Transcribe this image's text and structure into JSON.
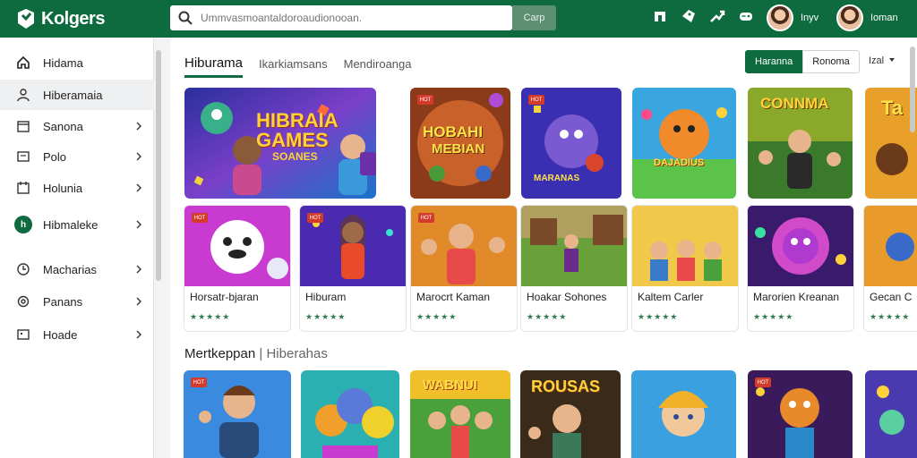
{
  "header": {
    "logo_text": "Kolgers",
    "search_placeholder": "Ummvasmoantaldoroaudionooan.",
    "search_button": "Carp",
    "user1_name": "Inyv",
    "user2_name": "Ioman"
  },
  "sidebar": {
    "items": [
      {
        "label": "Hidama",
        "icon": "home-icon",
        "chevron": false
      },
      {
        "label": "Hiberamaia",
        "icon": "user-icon",
        "chevron": false,
        "active": true
      },
      {
        "label": "Sanona",
        "icon": "calendar-icon",
        "chevron": true
      },
      {
        "label": "Polo",
        "icon": "image-icon",
        "chevron": true
      },
      {
        "label": "Holunia",
        "icon": "calendar-icon",
        "chevron": true
      },
      {
        "label": "Hibmaleke",
        "icon": "badge-icon",
        "badge": "h",
        "chevron": true
      },
      {
        "label": "Macharias",
        "icon": "clock-icon",
        "chevron": true
      },
      {
        "label": "Panans",
        "icon": "settings-icon",
        "chevron": true
      },
      {
        "label": "Hoade",
        "icon": "chat-icon",
        "chevron": true
      }
    ]
  },
  "main": {
    "tabs": [
      "Hiburama",
      "Ikarkiamsans",
      "Mendiroanga"
    ],
    "active_tab": 0,
    "segment": [
      "Haranna",
      "Ronoma"
    ],
    "sort_label": "Izal",
    "featured_title": "HIBRAIA GAMES",
    "featured_sub": "SOANES",
    "row1_texts": [
      "HOBAHI",
      "MEBIAN",
      "MARANAS",
      "DAJADIUS",
      "CONNMA",
      "Ta"
    ],
    "cards": [
      {
        "title": "Horsatr-bjaran",
        "rating": 5
      },
      {
        "title": "Hiburam",
        "rating": 5
      },
      {
        "title": "Marocrt Kaman",
        "rating": 5
      },
      {
        "title": "Hoakar Sohones",
        "rating": 5
      },
      {
        "title": "Kaltem Carler",
        "rating": 5
      },
      {
        "title": "Marorien Kreanan",
        "rating": 5
      },
      {
        "title": "Gecan C",
        "rating": 5
      }
    ],
    "card_badges": [
      "HOT",
      "HOT",
      "HOT",
      "HOT",
      "HOT"
    ],
    "section_title": "Mertkeppan",
    "section_sub": "Hiberahas",
    "row3_texts": [
      "WABNUI",
      "ROUSAS"
    ],
    "stars_glyph": "★★★★★"
  },
  "colors": {
    "brand": "#0e6b3f",
    "accent_star": "#2e7d4f"
  }
}
